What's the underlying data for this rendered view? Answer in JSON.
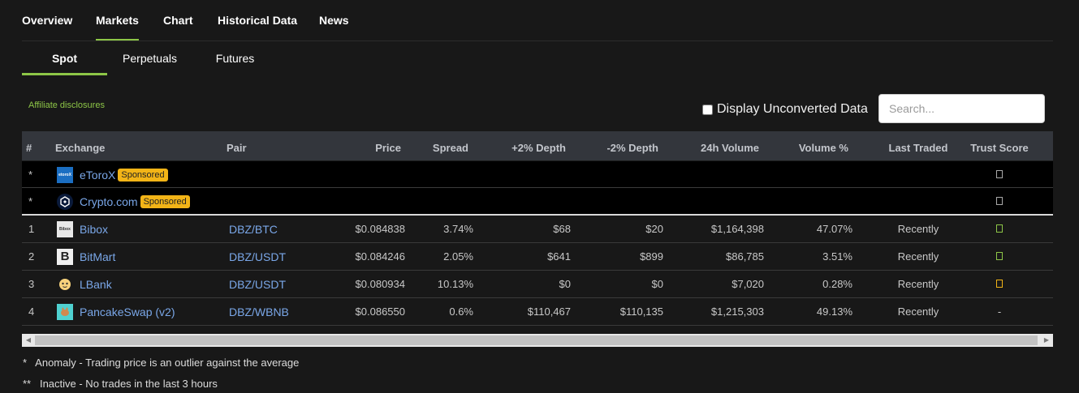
{
  "top_tabs": [
    "Overview",
    "Markets",
    "Chart",
    "Historical Data",
    "News"
  ],
  "sub_tabs": [
    "Spot",
    "Perpetuals",
    "Futures"
  ],
  "affiliate": "Affiliate disclosures",
  "unconverted_label": "Display Unconverted Data",
  "search_placeholder": "Search...",
  "columns": [
    "#",
    "Exchange",
    "Pair",
    "Price",
    "Spread",
    "+2% Depth",
    "-2% Depth",
    "24h Volume",
    "Volume %",
    "Last Traded",
    "Trust Score"
  ],
  "sponsored": [
    {
      "num": "*",
      "exchange": "eToroX",
      "badge": "Sponsored",
      "logo_text": "etoroX",
      "logo_color": "#1b6ec2"
    },
    {
      "num": "*",
      "exchange": "Crypto.com",
      "badge": "Sponsored",
      "logo_text": "",
      "logo_color": "#0a1a3a"
    }
  ],
  "rows": [
    {
      "num": "1",
      "exchange": "Bibox",
      "pair": "DBZ/BTC",
      "price": "$0.084838",
      "spread": "3.74%",
      "depth_plus": "$68",
      "depth_minus": "$20",
      "volume": "$1,164,398",
      "volume_pct": "47.07%",
      "last_traded": "Recently",
      "trust": "green",
      "trust_color": "#8dc647",
      "logo_text": "Bibox",
      "logo_color": "#e8e8e8"
    },
    {
      "num": "2",
      "exchange": "BitMart",
      "pair": "DBZ/USDT",
      "price": "$0.084246",
      "spread": "2.05%",
      "depth_plus": "$641",
      "depth_minus": "$899",
      "volume": "$86,785",
      "volume_pct": "3.51%",
      "last_traded": "Recently",
      "trust": "green",
      "trust_color": "#8dc647",
      "logo_text": "B",
      "logo_color": "#f0f0f0"
    },
    {
      "num": "3",
      "exchange": "LBank",
      "pair": "DBZ/USDT",
      "price": "$0.080934",
      "spread": "10.13%",
      "depth_plus": "$0",
      "depth_minus": "$0",
      "volume": "$7,020",
      "volume_pct": "0.28%",
      "last_traded": "Recently",
      "trust": "yellow",
      "trust_color": "#f2b417",
      "logo_text": "",
      "logo_color": "#f7d27c"
    },
    {
      "num": "4",
      "exchange": "PancakeSwap (v2)",
      "pair": "DBZ/WBNB",
      "price": "$0.086550",
      "spread": "0.6%",
      "depth_plus": "$110,467",
      "depth_minus": "$110,135",
      "volume": "$1,215,303",
      "volume_pct": "49.13%",
      "last_traded": "Recently",
      "trust": "-",
      "trust_color": "",
      "logo_text": "",
      "logo_color": "#4fd1d0"
    }
  ],
  "notes": [
    "*   Anomaly - Trading price is an outlier against the average",
    "**   Inactive - No trades in the last 3 hours"
  ],
  "colors": {
    "accent": "#8dc647",
    "link": "#7aa7e8",
    "sponsored": "#f2b417"
  }
}
